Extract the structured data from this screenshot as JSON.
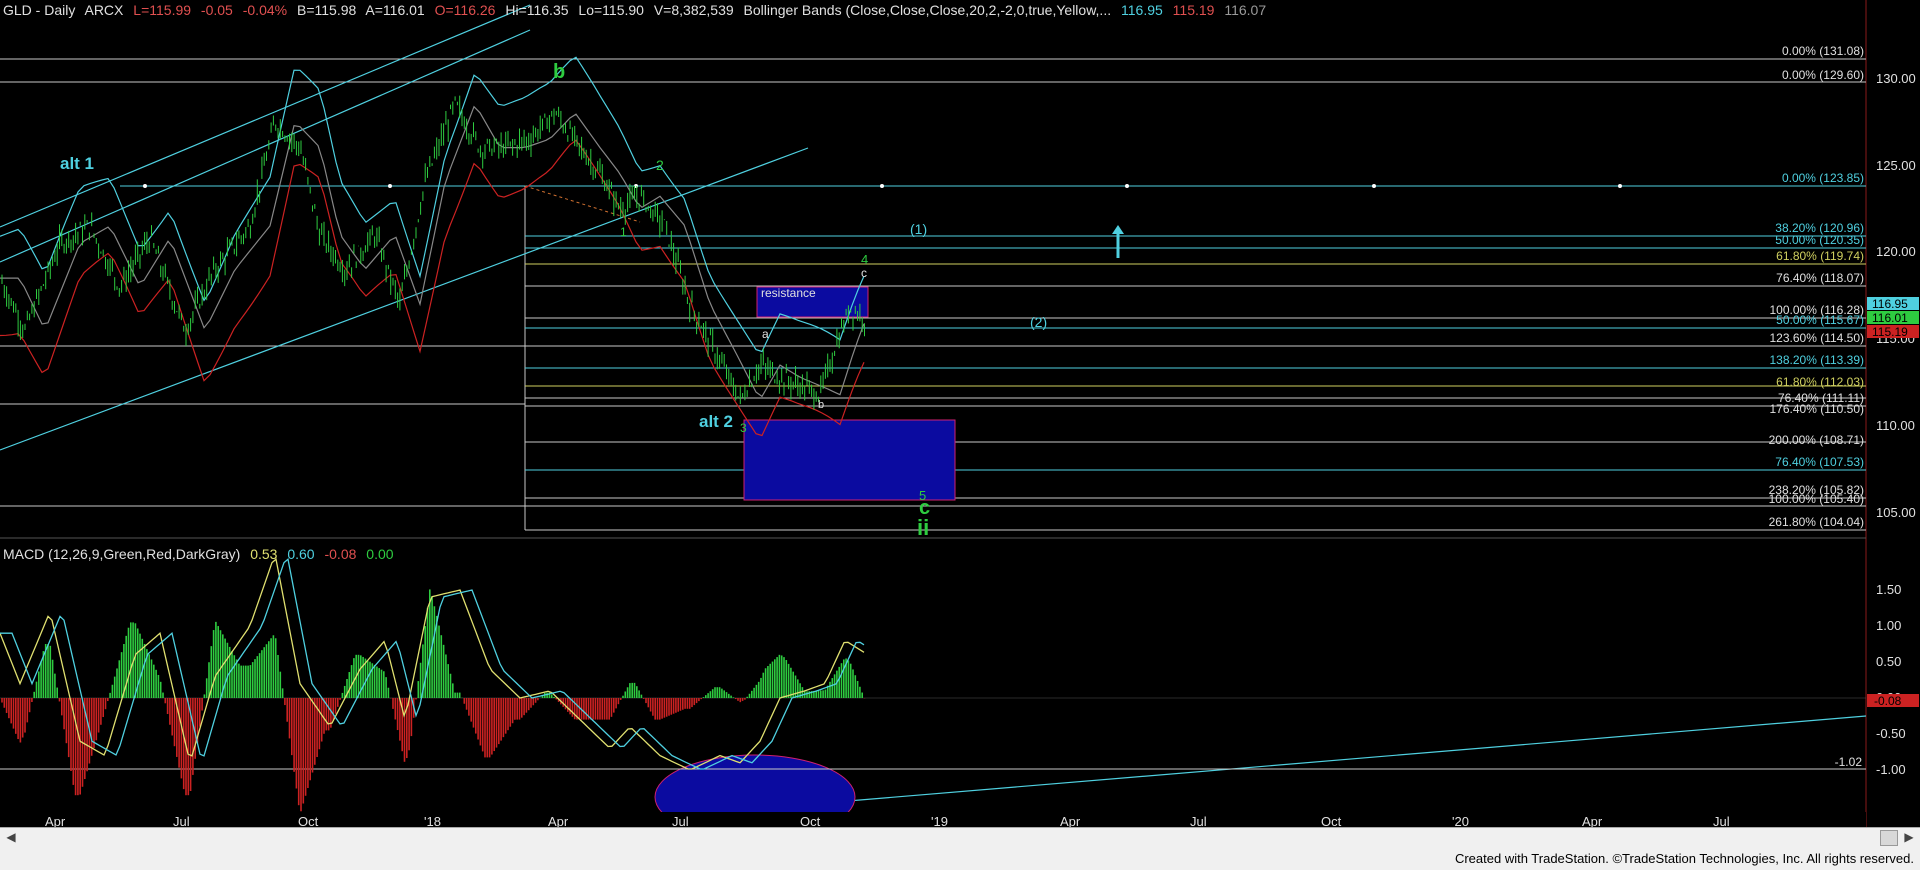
{
  "header": {
    "symbol": "GLD - Daily",
    "exchange": "ARCX",
    "last": "L=115.99",
    "change": "-0.05",
    "change_pct": "-0.04%",
    "bid": "B=115.98",
    "ask": "A=116.01",
    "open": "O=116.26",
    "high": "Hi=116.35",
    "low": "Lo=115.90",
    "volume": "V=8,382,539",
    "indicator": "Bollinger Bands (Close,Close,Close,20,2,-2,0,true,Yellow,...",
    "bb_upper": "116.95",
    "bb_lower": "115.19",
    "bb_mid": "116.07"
  },
  "macd_header": {
    "label": "MACD (12,26,9,Green,Red,DarkGray)",
    "v1": "0.53",
    "v2": "0.60",
    "v3": "-0.08",
    "v4": "0.00"
  },
  "colors": {
    "cyan": "#4fd0e0",
    "green": "#2ecc40",
    "red": "#cc2222",
    "yellow": "#e0e070",
    "grid_white": "#c8c8c8",
    "box_blue": "#0b0ba0",
    "box_border": "#d02070"
  },
  "price_axis": [
    "130.00",
    "125.00",
    "120.00",
    "115.00",
    "110.00",
    "105.00"
  ],
  "macd_axis": [
    "1.50",
    "1.00",
    "0.50",
    "0.00",
    "-0.50",
    "-1.00"
  ],
  "macd_tags": {
    "neg": "-0.08",
    "low": "-1.02"
  },
  "price_tags": {
    "upper": "116.95",
    "mid": "116.01",
    "lower": "115.19"
  },
  "time_axis": [
    "Apr",
    "Jul",
    "Oct",
    "'18",
    "Apr",
    "Jul",
    "Oct",
    "'19",
    "Apr",
    "Jul",
    "Oct",
    "'20",
    "Apr",
    "Jul"
  ],
  "fib_labels": [
    {
      "text": "0.00% (131.08)",
      "color": "#e0e0e0"
    },
    {
      "text": "0.00% (129.60)",
      "color": "#e0e0e0"
    },
    {
      "text": "0.00% (123.85)",
      "color": "#4fd0e0"
    },
    {
      "text": "38.20% (120.96)",
      "color": "#4fd0e0"
    },
    {
      "text": "50.00% (120.35)",
      "color": "#4fd0e0"
    },
    {
      "text": "61.80% (119.74)",
      "color": "#d0d060"
    },
    {
      "text": "76.40% (118.07)",
      "color": "#e0e0e0"
    },
    {
      "text": "100.00% (116.28)",
      "color": "#e0e0e0"
    },
    {
      "text": "50.00% (115.67)",
      "color": "#4fd0e0"
    },
    {
      "text": "123.60% (114.50)",
      "color": "#e0e0e0"
    },
    {
      "text": "138.20% (113.39)",
      "color": "#4fd0e0"
    },
    {
      "text": "61.80% (112.03)",
      "color": "#d0d060"
    },
    {
      "text": "76.40% (111.11)",
      "color": "#e0e0e0"
    },
    {
      "text": "176.40% (110.50)",
      "color": "#e0e0e0"
    },
    {
      "text": "200.00% (108.71)",
      "color": "#e0e0e0"
    },
    {
      "text": "76.40% (107.53)",
      "color": "#4fd0e0"
    },
    {
      "text": "238.20% (105.82)",
      "color": "#e0e0e0"
    },
    {
      "text": "100.00% (105.40)",
      "color": "#e0e0e0"
    },
    {
      "text": "261.80% (104.04)",
      "color": "#e0e0e0"
    }
  ],
  "wave_labels": {
    "b": "b",
    "alt1": "alt 1",
    "w2": "2",
    "w1": "1",
    "paren1": "(1)",
    "paren2": "(2)",
    "w4": "4",
    "c_small": "c",
    "resistance": "resistance",
    "a_small": "a",
    "b_small": "b",
    "alt2": "alt 2",
    "w3": "3",
    "w5": "5",
    "c_big": "c",
    "ii": "ii"
  },
  "footer": {
    "credit": "Created with TradeStation. ©TradeStation Technologies, Inc. All rights reserved."
  }
}
